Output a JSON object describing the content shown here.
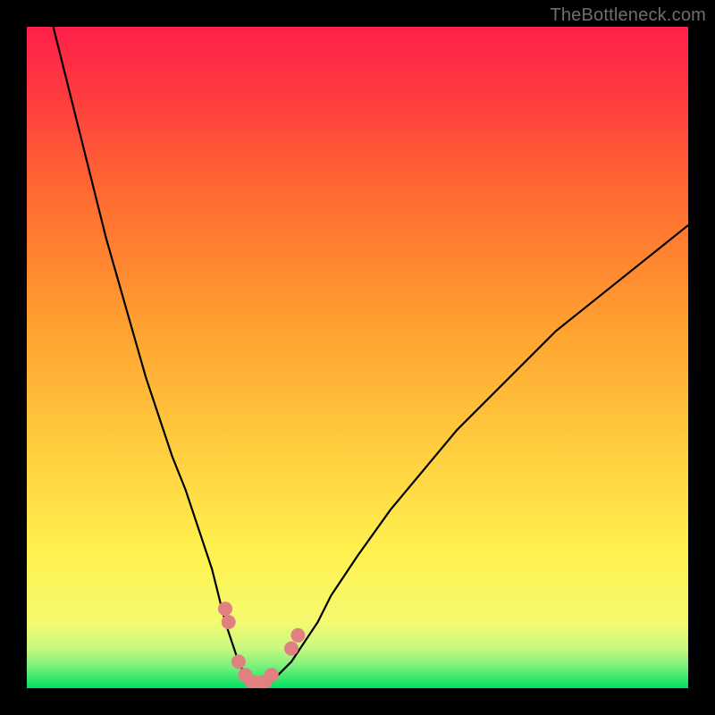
{
  "watermark": "TheBottleneck.com",
  "chart_data": {
    "type": "line",
    "title": "",
    "xlabel": "",
    "ylabel": "",
    "xlim": [
      0,
      100
    ],
    "ylim": [
      0,
      100
    ],
    "background_gradient_stops": [
      {
        "offset": 0.0,
        "color": "#00e060"
      },
      {
        "offset": 0.03,
        "color": "#6ff07a"
      },
      {
        "offset": 0.06,
        "color": "#c8f880"
      },
      {
        "offset": 0.1,
        "color": "#f5fa70"
      },
      {
        "offset": 0.2,
        "color": "#fff250"
      },
      {
        "offset": 0.35,
        "color": "#ffd040"
      },
      {
        "offset": 0.55,
        "color": "#ffa030"
      },
      {
        "offset": 0.75,
        "color": "#ff6a30"
      },
      {
        "offset": 0.9,
        "color": "#ff3a40"
      },
      {
        "offset": 1.0,
        "color": "#ff1f4a"
      }
    ],
    "series": [
      {
        "name": "bottleneck-curve",
        "color": "#000000",
        "x": [
          4,
          6,
          8,
          10,
          12,
          14,
          16,
          18,
          20,
          22,
          24,
          26,
          28,
          29,
          30,
          31,
          32,
          33,
          34,
          35,
          36,
          37,
          38,
          40,
          42,
          44,
          46,
          50,
          55,
          60,
          65,
          70,
          75,
          80,
          85,
          90,
          95,
          100
        ],
        "y": [
          100,
          92,
          84,
          76,
          68,
          61,
          54,
          47,
          41,
          35,
          30,
          24,
          18,
          14,
          10,
          7,
          4,
          2,
          1,
          0.5,
          0.5,
          1,
          2,
          4,
          7,
          10,
          14,
          20,
          27,
          33,
          39,
          44,
          49,
          54,
          58,
          62,
          66,
          70
        ]
      }
    ],
    "markers": {
      "name": "highlight-points",
      "color": "#e08080",
      "points": [
        {
          "x": 30,
          "y": 12
        },
        {
          "x": 30.5,
          "y": 10
        },
        {
          "x": 32,
          "y": 4
        },
        {
          "x": 33,
          "y": 2
        },
        {
          "x": 34,
          "y": 1
        },
        {
          "x": 35,
          "y": 0.8
        },
        {
          "x": 36,
          "y": 1
        },
        {
          "x": 37,
          "y": 2
        },
        {
          "x": 40,
          "y": 6
        },
        {
          "x": 41,
          "y": 8
        }
      ]
    }
  }
}
